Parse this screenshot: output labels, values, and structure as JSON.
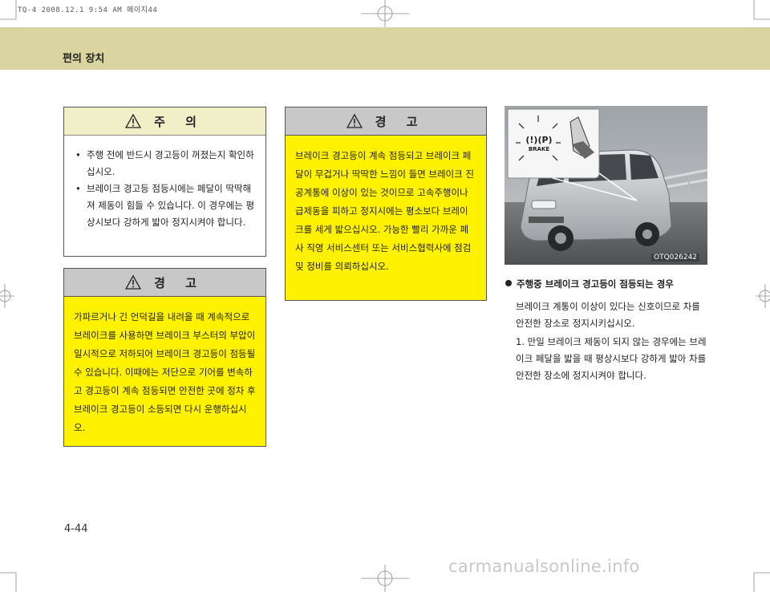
{
  "print_info": "TQ-4  2008.12.1 9:54 AM  페이지44",
  "header": {
    "title": "편의 장치"
  },
  "caution_box": {
    "title": "주 의",
    "items": [
      "주행 전에 반드시 경고등이 꺼졌는지 확인하십시오.",
      "브레이크 경고등 점등시에는 페달이 딱딱해져 제동이 힘들 수 있습니다. 이 경우에는 평상시보다 강하게 밟아 정지시켜야 합니다."
    ]
  },
  "warning_box_1": {
    "title": "경 고",
    "text": "가파르거나 긴 언덕길을 내려올 때 계속적으로 브레이크를 사용하면 브레이크 부스터의 부압이 일시적으로 저하되어 브레이크 경고등이 점등될 수 있습니다. 이때에는 저단으로 기어를 변속하고 경고등이 계속 점등되면 안전한 곳에 정차 후 브레이크 경고등이 소등되면 다시 운행하십시오."
  },
  "warning_box_2": {
    "title": "경 고",
    "text": "브레이크 경고등이 계속 점등되고 브레이크 페달이 무겁거나 딱딱한 느낌이 들면 브레이크 진공계통에 이상이 있는 것이므로 고속주행이나 급제동을 피하고 정지시에는 평소보다 브레이크를 세게 밟으십시오. 가능한 빨리 가까운 폐사 직영 서비스센터 또는 서비스협력사에 점검 및 정비를 의뢰하십시오."
  },
  "figure": {
    "code": "OTQ026242",
    "lamp_symbol": "(!)(P)",
    "lamp_label": "BRAKE"
  },
  "right_section": {
    "title": "주행중 브레이크 경고등이 점등되는 경우",
    "body": "브레이크 계통이 이상이 있다는 신호이므로 차를 안전한 장소로 정지시키십시오.",
    "note": "1. 만일 브레이크 제동이 되지 않는 경우에는 브레이크 페달을 밟을 때 평상시보다 강하게 밟아 차를 안전한 장소에 정지시켜야 합니다."
  },
  "page_number": "4-44",
  "footer_watermark": "carmanualsonline.info",
  "colors": {
    "header_band": "#d9d4a0",
    "warning_fill": "#fff200",
    "caution_head": "#f1efc8"
  }
}
